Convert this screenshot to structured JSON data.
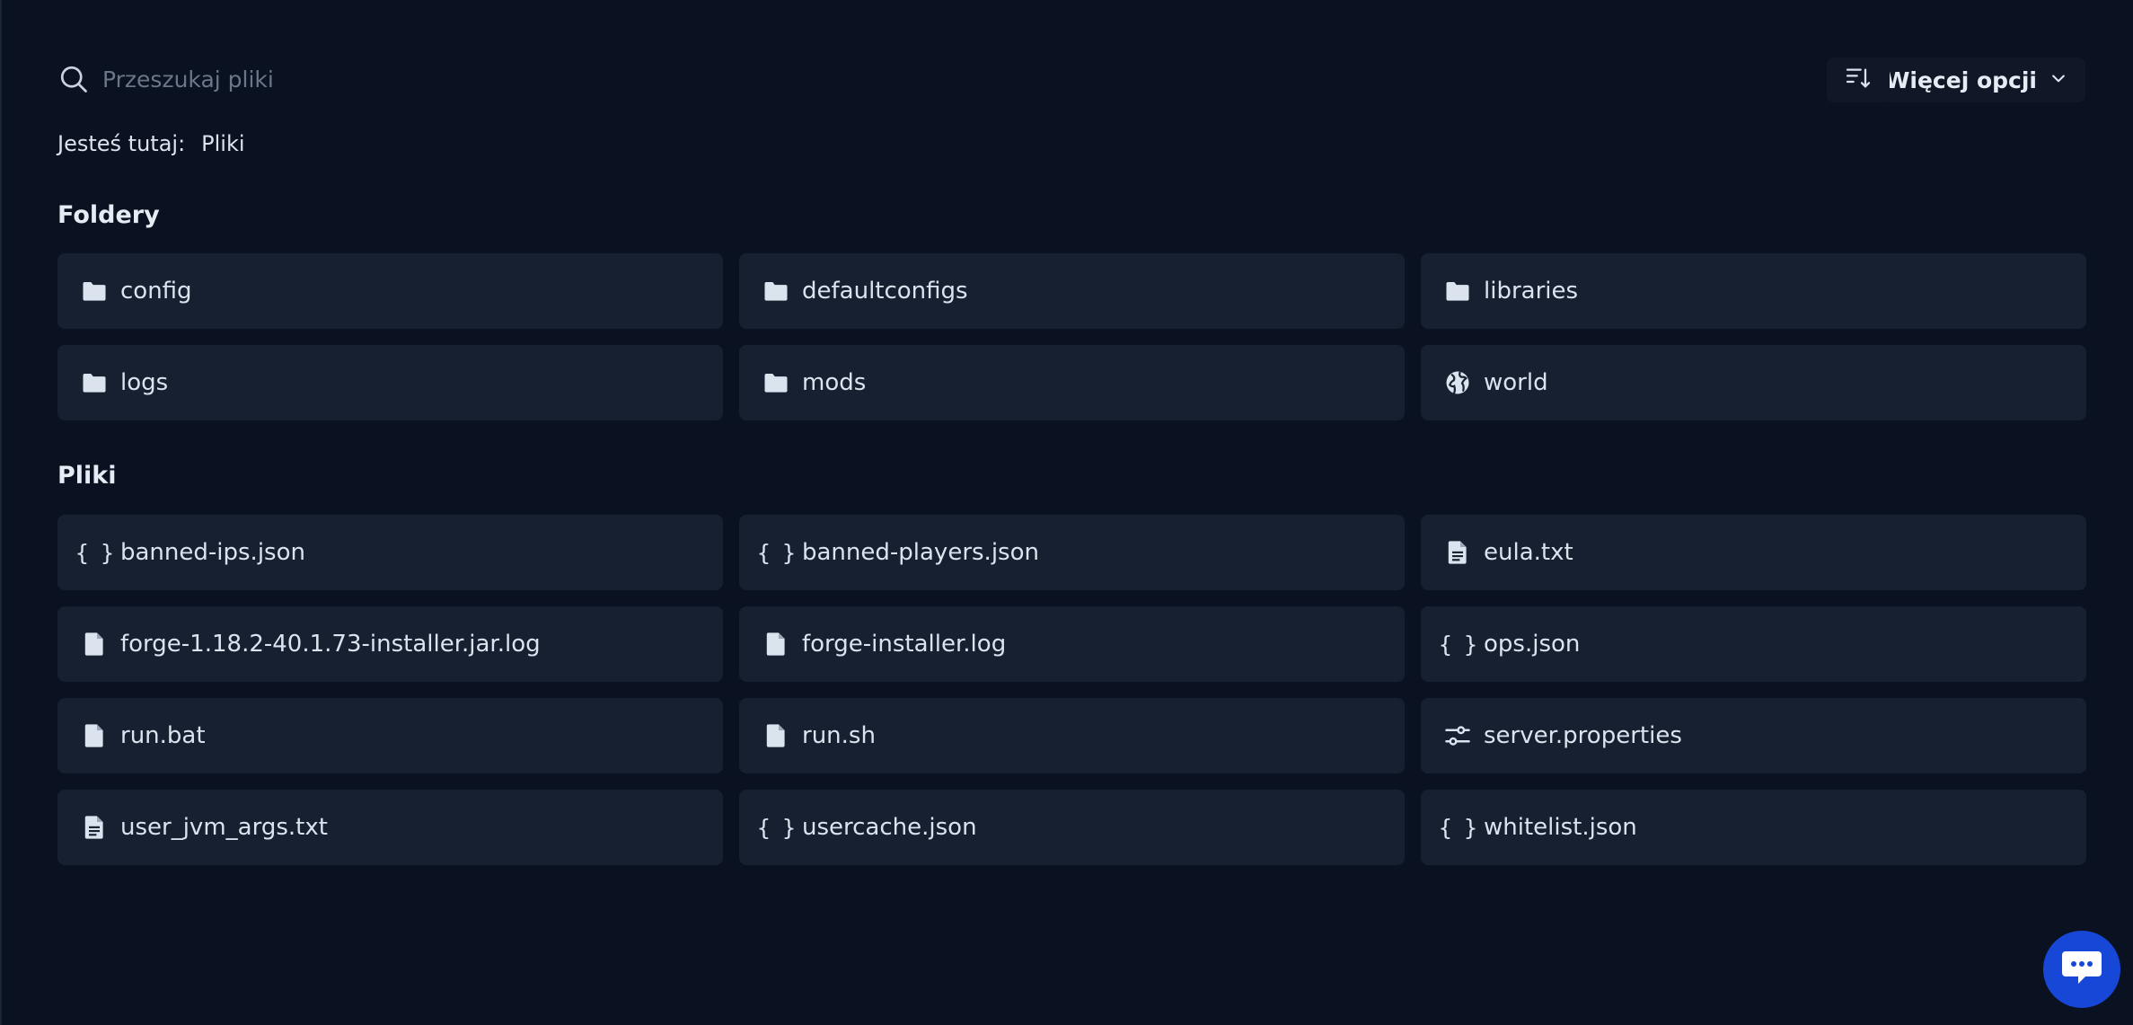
{
  "search": {
    "placeholder": "Przeszukaj pliki",
    "value": ""
  },
  "toolbar": {
    "sort_icon": "sort-descending-icon",
    "more_label": "Więcej opcji"
  },
  "breadcrumb": {
    "prefix": "Jesteś tutaj:",
    "items": [
      "Pliki"
    ]
  },
  "folders_section": {
    "title": "Foldery",
    "items": [
      {
        "name": "config",
        "icon": "folder-icon"
      },
      {
        "name": "defaultconfigs",
        "icon": "folder-icon"
      },
      {
        "name": "libraries",
        "icon": "folder-icon"
      },
      {
        "name": "logs",
        "icon": "folder-icon"
      },
      {
        "name": "mods",
        "icon": "folder-icon"
      },
      {
        "name": "world",
        "icon": "globe-icon"
      }
    ]
  },
  "files_section": {
    "title": "Pliki",
    "items": [
      {
        "name": "banned-ips.json",
        "icon": "json-braces-icon"
      },
      {
        "name": "banned-players.json",
        "icon": "json-braces-icon"
      },
      {
        "name": "eula.txt",
        "icon": "text-file-icon"
      },
      {
        "name": "forge-1.18.2-40.1.73-installer.jar.log",
        "icon": "file-icon"
      },
      {
        "name": "forge-installer.log",
        "icon": "file-icon"
      },
      {
        "name": "ops.json",
        "icon": "json-braces-icon"
      },
      {
        "name": "run.bat",
        "icon": "file-icon"
      },
      {
        "name": "run.sh",
        "icon": "file-icon"
      },
      {
        "name": "server.properties",
        "icon": "sliders-icon"
      },
      {
        "name": "user_jvm_args.txt",
        "icon": "text-file-icon"
      },
      {
        "name": "usercache.json",
        "icon": "json-braces-icon"
      },
      {
        "name": "whitelist.json",
        "icon": "json-braces-icon"
      }
    ]
  },
  "chat": {
    "icon": "chat-bubble-icon"
  }
}
